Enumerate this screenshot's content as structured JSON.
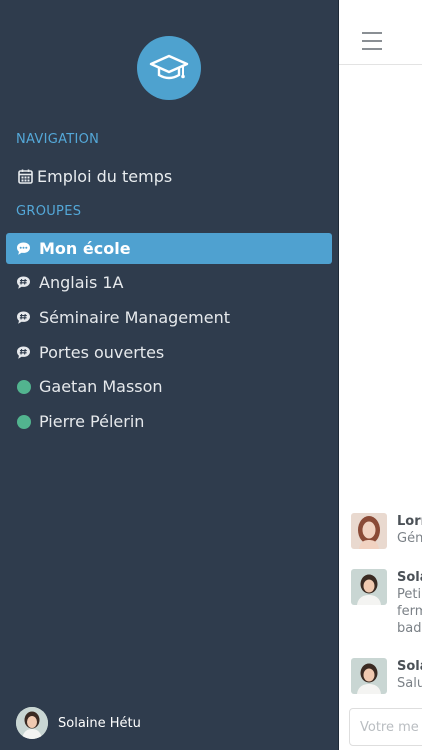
{
  "drawer": {
    "navigation_label": "NAVIGATION",
    "nav_items": [
      {
        "label": "Emploi du temps",
        "icon": "calendar-icon"
      }
    ],
    "groups_label": "GROUPES",
    "groups": [
      {
        "label": "Mon école",
        "icon": "chat-bubble-icon",
        "active": true
      },
      {
        "label": "Anglais 1A",
        "icon": "group-chat-icon"
      },
      {
        "label": "Séminaire Management",
        "icon": "group-chat-icon"
      },
      {
        "label": "Portes ouvertes",
        "icon": "group-chat-icon"
      },
      {
        "label": "Gaetan Masson",
        "icon": "online-dot-icon"
      },
      {
        "label": "Pierre Pélerin",
        "icon": "online-dot-icon"
      }
    ],
    "current_user": "Solaine Hétu",
    "logo_icon": "graduation-cap-icon"
  },
  "main": {
    "menu_icon": "hamburger-icon",
    "messages": [
      {
        "author": "Lorr",
        "lines": [
          "Gén"
        ]
      },
      {
        "author": "Sola",
        "lines": [
          "Peti",
          "ferm",
          "badg"
        ]
      },
      {
        "author": "Sola",
        "lines": [
          "Salu"
        ]
      }
    ],
    "composer_placeholder": "Votre me"
  },
  "colors": {
    "drawer_bg": "#2f3c4d",
    "accent": "#4fa1d0",
    "section_label": "#54a8d8",
    "online": "#52b48f"
  }
}
